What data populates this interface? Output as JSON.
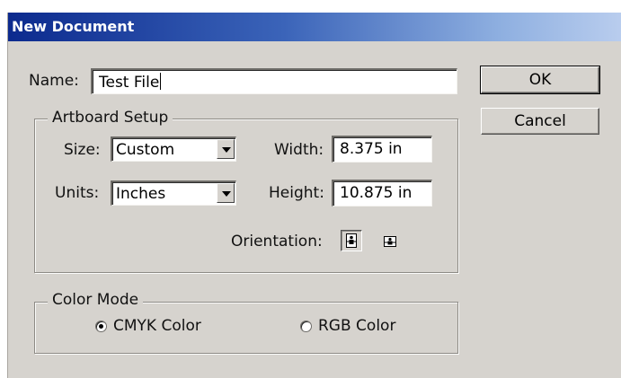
{
  "window": {
    "title": "New Document"
  },
  "name_field": {
    "label": "Name:",
    "value": "Test File"
  },
  "buttons": {
    "ok": "OK",
    "cancel": "Cancel"
  },
  "artboard_setup": {
    "legend": "Artboard Setup",
    "size": {
      "label": "Size:",
      "value": "Custom"
    },
    "units": {
      "label": "Units:",
      "value": "Inches"
    },
    "width": {
      "label": "Width:",
      "value": "8.375 in"
    },
    "height": {
      "label": "Height:",
      "value": "10.875 in"
    },
    "orientation": {
      "label": "Orientation:",
      "selected": "portrait",
      "options": [
        "portrait-icon",
        "landscape-icon"
      ]
    }
  },
  "color_mode": {
    "legend": "Color Mode",
    "options": [
      {
        "label": "CMYK Color",
        "checked": true
      },
      {
        "label": "RGB Color",
        "checked": false
      }
    ]
  }
}
